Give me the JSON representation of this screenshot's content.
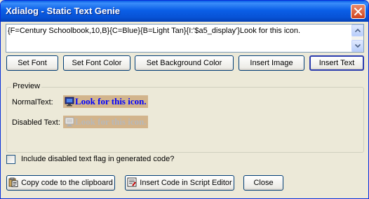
{
  "window": {
    "title": "Xdialog - Static Text Genie"
  },
  "editor": {
    "value": "{F=Century Schoolbook,10,B}{C=Blue}{B=Light Tan}{I:'$a5_display'}Look for this icon."
  },
  "toolbar": {
    "set_font": "Set Font",
    "set_font_color": "Set Font Color",
    "set_background_color": "Set Background Color",
    "insert_image": "Insert Image",
    "insert_text": "Insert Text"
  },
  "preview": {
    "group_label": "Preview",
    "normal_label": "NormalText:",
    "normal_sample": "Look for this icon.",
    "disabled_label": "Disabled Text:",
    "disabled_sample": "Look for this icon.",
    "sample_text_color": "#0000ff",
    "sample_background": "#d2b48c",
    "disabled_text_color": "#b8b8b8",
    "icon": "display-icon"
  },
  "options": {
    "include_disabled_label": "Include disabled text flag in generated code?",
    "include_disabled_checked": false
  },
  "footer": {
    "copy_code": "Copy code to the clipboard",
    "insert_code": "Insert Code in Script Editor",
    "close": "Close"
  }
}
